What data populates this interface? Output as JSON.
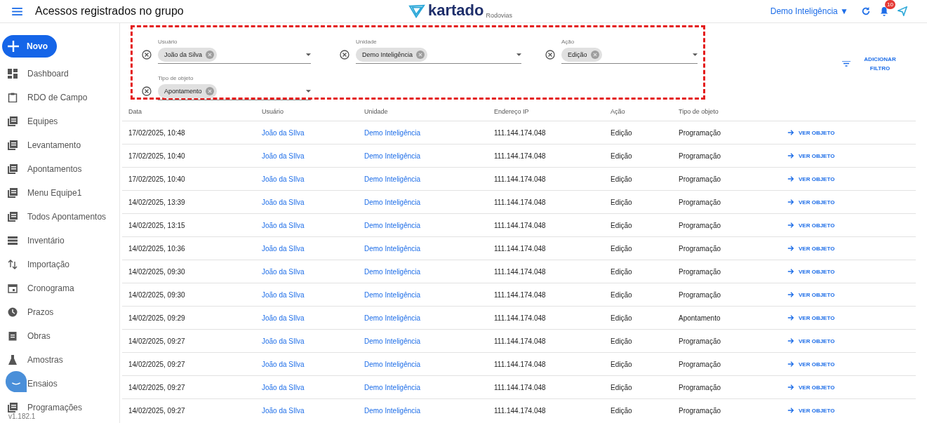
{
  "header": {
    "title": "Acessos registrados no grupo",
    "logo_word": "kartado",
    "logo_sub": "Rodovias",
    "company": "Demo Inteligência ▼",
    "notifications": "10"
  },
  "sidebar": {
    "new_button": "Novo",
    "items": [
      {
        "label": "Dashboard"
      },
      {
        "label": "RDO de Campo"
      },
      {
        "label": "Equipes"
      },
      {
        "label": "Levantamento"
      },
      {
        "label": "Apontamentos"
      },
      {
        "label": "Menu Equipe1"
      },
      {
        "label": "Todos Apontamentos"
      },
      {
        "label": "Inventário"
      },
      {
        "label": "Importação"
      },
      {
        "label": "Cronograma"
      },
      {
        "label": "Prazos"
      },
      {
        "label": "Obras"
      },
      {
        "label": "Amostras"
      },
      {
        "label": "Ensaios"
      },
      {
        "label": "Programações"
      }
    ],
    "version": "v1.182.1"
  },
  "filters": [
    {
      "label": "Usuário",
      "chip": "João da Silva"
    },
    {
      "label": "Unidade",
      "chip": "Demo Inteligência"
    },
    {
      "label": "Ação",
      "chip": "Edição"
    },
    {
      "label": "Tipo de objeto",
      "chip": "Apontamento"
    }
  ],
  "add_filter": "ADICIONAR FILTRO",
  "table": {
    "columns": [
      "Data",
      "Usuário",
      "Unidade",
      "Endereço IP",
      "Ação",
      "Tipo de objeto"
    ],
    "rows": [
      [
        "17/02/2025, 10:48",
        "João da SIlva",
        "Demo Inteligência",
        "111.144.174.048",
        "Edição",
        "Programação",
        "VER OBJETO"
      ],
      [
        "17/02/2025, 10:40",
        "João da SIlva",
        "Demo Inteligência",
        "111.144.174.048",
        "Edição",
        "Programação",
        "VER OBJETO"
      ],
      [
        "17/02/2025, 10:40",
        "João da SIlva",
        "Demo Inteligência",
        "111.144.174.048",
        "Edição",
        "Programação",
        "VER OBJETO"
      ],
      [
        "14/02/2025, 13:39",
        "João da SIlva",
        "Demo Inteligência",
        "111.144.174.048",
        "Edição",
        "Programação",
        "VER OBJETO"
      ],
      [
        "14/02/2025, 13:15",
        "João da SIlva",
        "Demo Inteligência",
        "111.144.174.048",
        "Edição",
        "Programação",
        "VER OBJETO"
      ],
      [
        "14/02/2025, 10:36",
        "João da SIlva",
        "Demo Inteligência",
        "111.144.174.048",
        "Edição",
        "Programação",
        "VER OBJETO"
      ],
      [
        "14/02/2025, 09:30",
        "João da SIlva",
        "Demo Inteligência",
        "111.144.174.048",
        "Edição",
        "Programação",
        "VER OBJETO"
      ],
      [
        "14/02/2025, 09:30",
        "João da SIlva",
        "Demo Inteligência",
        "111.144.174.048",
        "Edição",
        "Programação",
        "VER OBJETO"
      ],
      [
        "14/02/2025, 09:29",
        "João da SIlva",
        "Demo Inteligência",
        "111.144.174.048",
        "Edição",
        "Apontamento",
        "VER OBJETO"
      ],
      [
        "14/02/2025, 09:27",
        "João da SIlva",
        "Demo Inteligência",
        "111.144.174.048",
        "Edição",
        "Programação",
        "VER OBJETO"
      ],
      [
        "14/02/2025, 09:27",
        "João da SIlva",
        "Demo Inteligência",
        "111.144.174.048",
        "Edição",
        "Programação",
        "VER OBJETO"
      ],
      [
        "14/02/2025, 09:27",
        "João da SIlva",
        "Demo Inteligência",
        "111.144.174.048",
        "Edição",
        "Programação",
        "VER OBJETO"
      ],
      [
        "14/02/2025, 09:27",
        "João da SIlva",
        "Demo Inteligência",
        "111.144.174.048",
        "Edição",
        "Programação",
        "VER OBJETO"
      ]
    ]
  }
}
